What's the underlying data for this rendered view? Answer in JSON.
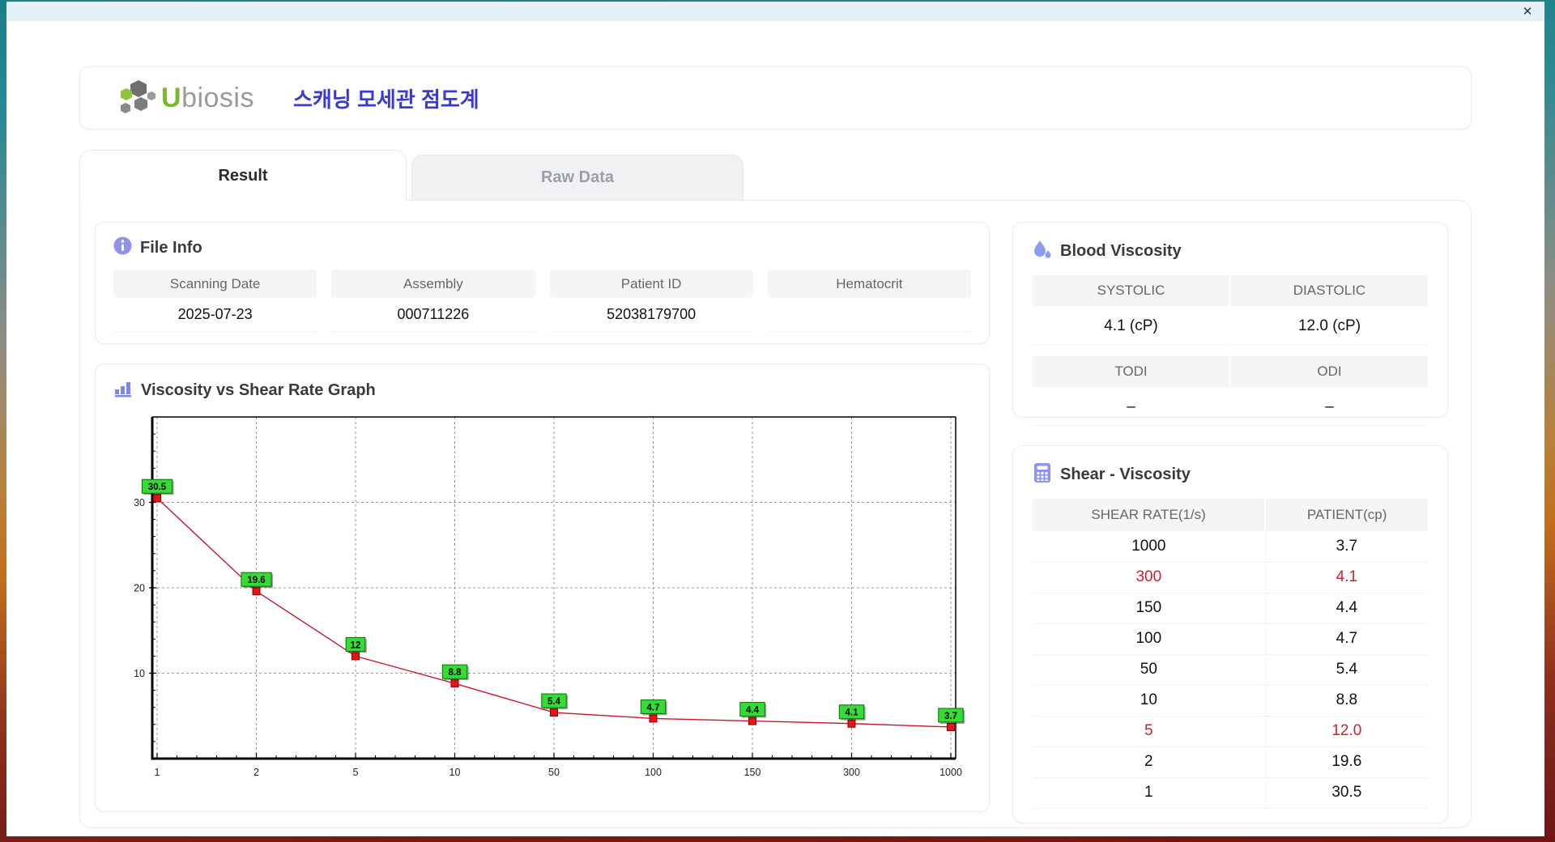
{
  "window": {
    "close_glyph": "✕"
  },
  "header": {
    "logo_icon": "ubiosis-logo-icon",
    "logo_u": "U",
    "logo_rest": "biosis",
    "title_ko": "스캐닝 모세관 점도계"
  },
  "tabs": [
    {
      "label": "Result",
      "active": true
    },
    {
      "label": "Raw Data",
      "active": false
    }
  ],
  "file_info": {
    "icon": "info-icon",
    "title": "File Info",
    "fields": [
      {
        "label": "Scanning Date",
        "value": "2025-07-23"
      },
      {
        "label": "Assembly",
        "value": "000711226"
      },
      {
        "label": "Patient ID",
        "value": "52038179700"
      },
      {
        "label": "Hematocrit",
        "value": ""
      }
    ]
  },
  "graph": {
    "icon": "bar-chart-icon",
    "title": "Viscosity vs Shear Rate Graph"
  },
  "blood_viscosity": {
    "icon": "droplet-icon",
    "title": "Blood Viscosity",
    "rows": [
      [
        {
          "label": "SYSTOLIC",
          "value": "4.1 (cP)"
        },
        {
          "label": "DIASTOLIC",
          "value": "12.0 (cP)"
        }
      ],
      [
        {
          "label": "TODI",
          "value": "–"
        },
        {
          "label": "ODI",
          "value": "–"
        }
      ]
    ]
  },
  "shear_viscosity": {
    "icon": "calculator-icon",
    "title": "Shear - Viscosity",
    "columns": [
      "SHEAR RATE(1/s)",
      "PATIENT(cp)"
    ],
    "rows": [
      {
        "shear": "1000",
        "patient": "3.7",
        "alert": false
      },
      {
        "shear": "300",
        "patient": "4.1",
        "alert": true
      },
      {
        "shear": "150",
        "patient": "4.4",
        "alert": false
      },
      {
        "shear": "100",
        "patient": "4.7",
        "alert": false
      },
      {
        "shear": "50",
        "patient": "5.4",
        "alert": false
      },
      {
        "shear": "10",
        "patient": "8.8",
        "alert": false
      },
      {
        "shear": "5",
        "patient": "12.0",
        "alert": true
      },
      {
        "shear": "2",
        "patient": "19.6",
        "alert": false
      },
      {
        "shear": "1",
        "patient": "30.5",
        "alert": false
      }
    ]
  },
  "chart_data": {
    "type": "line",
    "title": "Viscosity vs Shear Rate Graph",
    "x_categories": [
      1,
      2,
      5,
      10,
      50,
      100,
      150,
      300,
      1000
    ],
    "values": [
      30.5,
      19.6,
      12,
      8.8,
      5.4,
      4.7,
      4.4,
      4.1,
      3.7
    ],
    "point_labels": [
      "30.5",
      "19.6",
      "12",
      "8.8",
      "5.4",
      "4.7",
      "4.4",
      "4.1",
      "3.7"
    ],
    "xlabel": "",
    "ylabel": "",
    "ylim": [
      0,
      40
    ],
    "yticks": [
      10,
      20,
      30
    ],
    "x_spacing": "equal-categorical",
    "grid": "dashed",
    "legend": "none",
    "line_color": "#c81632",
    "marker_color": "#e81414",
    "point_label_bg": "#33dd33"
  }
}
